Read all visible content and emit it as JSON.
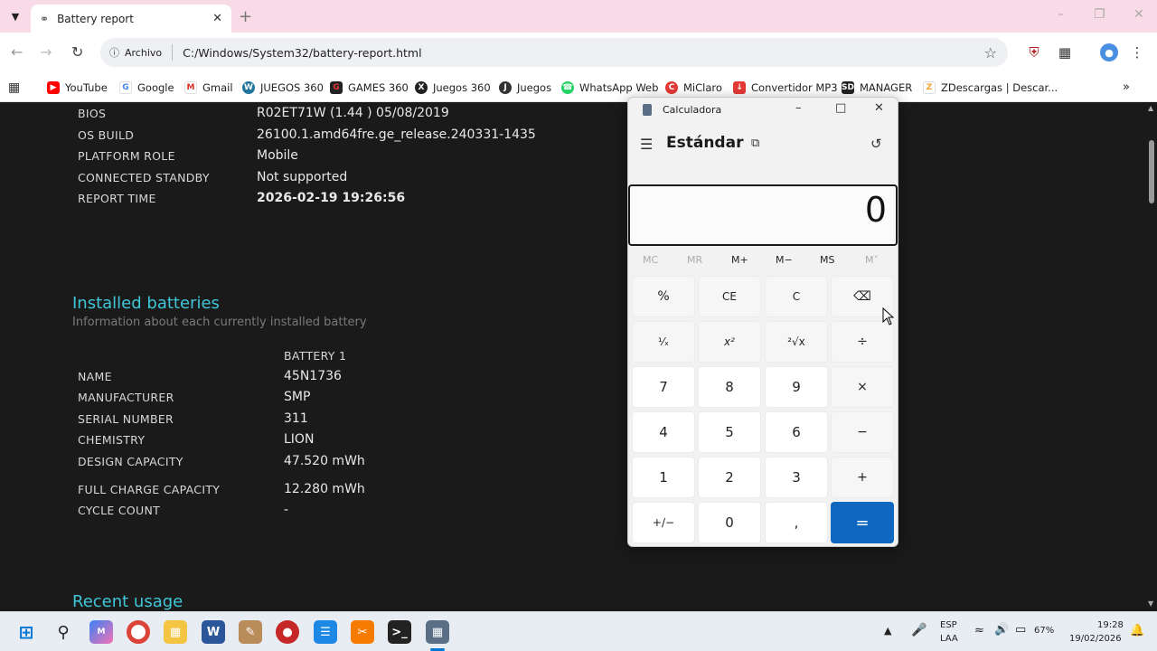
{
  "browser": {
    "tab_title": "Battery report",
    "address": {
      "site_label": "Archivo",
      "url": "C:/Windows/System32/battery-report.html"
    },
    "bookmarks": [
      {
        "label": "YouTube",
        "icon": "youtube-icon",
        "color": "#ff0000"
      },
      {
        "label": "Google",
        "icon": "google-icon",
        "color": "#4285f4"
      },
      {
        "label": "Gmail",
        "icon": "gmail-icon",
        "color": "#d93025"
      },
      {
        "label": "JUEGOS 360",
        "icon": "wordpress-icon",
        "color": "#21759b"
      },
      {
        "label": "GAMES 360",
        "icon": "games-icon",
        "color": "#c62828"
      },
      {
        "label": "Juegos 360",
        "icon": "xbox-icon",
        "color": "#222222"
      },
      {
        "label": "Juegos",
        "icon": "juegos-icon",
        "color": "#333333"
      },
      {
        "label": "WhatsApp Web",
        "icon": "whatsapp-icon",
        "color": "#25d366"
      },
      {
        "label": "MiClaro",
        "icon": "claro-icon",
        "color": "#e53935"
      },
      {
        "label": "Convertidor MP3",
        "icon": "download-icon",
        "color": "#e53935"
      },
      {
        "label": "MANAGER",
        "icon": "sd-icon",
        "color": "#222222"
      },
      {
        "label": "ZDescargas | Descar...",
        "icon": "z-icon",
        "color": "#f0a030"
      }
    ]
  },
  "report": {
    "system_rows": [
      {
        "label": "BIOS",
        "value": "R02ET71W (1.44 ) 05/08/2019"
      },
      {
        "label": "OS BUILD",
        "value": "26100.1.amd64fre.ge_release.240331-1435"
      },
      {
        "label": "PLATFORM ROLE",
        "value": "Mobile"
      },
      {
        "label": "CONNECTED STANDBY",
        "value": "Not supported"
      },
      {
        "label": "REPORT TIME",
        "value": "2026-02-19  19:26:56"
      }
    ],
    "installed": {
      "heading": "Installed batteries",
      "subtitle": "Information about each currently installed battery",
      "column_header": "BATTERY 1",
      "rows": [
        {
          "label": "NAME",
          "value": "45N1736"
        },
        {
          "label": "MANUFACTURER",
          "value": "SMP"
        },
        {
          "label": "SERIAL NUMBER",
          "value": "311"
        },
        {
          "label": "CHEMISTRY",
          "value": "LION"
        },
        {
          "label": "DESIGN CAPACITY",
          "value": "47.520 mWh"
        },
        {
          "label": "FULL CHARGE CAPACITY",
          "value": "12.280 mWh"
        },
        {
          "label": "CYCLE COUNT",
          "value": "-"
        }
      ]
    },
    "recent_heading": "Recent usage"
  },
  "calculator": {
    "title": "Calculadora",
    "mode": "Estándar",
    "display": "0",
    "memory": [
      "MC",
      "MR",
      "M+",
      "M−",
      "MS",
      "M˅"
    ],
    "keys": [
      [
        "%",
        "CE",
        "C",
        "⌫"
      ],
      [
        "¹⁄ₓ",
        "x²",
        "²√x",
        "÷"
      ],
      [
        "7",
        "8",
        "9",
        "×"
      ],
      [
        "4",
        "5",
        "6",
        "−"
      ],
      [
        "1",
        "2",
        "3",
        "+"
      ],
      [
        "+/−",
        "0",
        ",",
        "="
      ]
    ],
    "accent_color": "#0f67c0"
  },
  "taskbar": {
    "language": "ESP",
    "layout": "LAA",
    "battery": "67%",
    "time": "19:28",
    "date": "19/02/2026"
  }
}
